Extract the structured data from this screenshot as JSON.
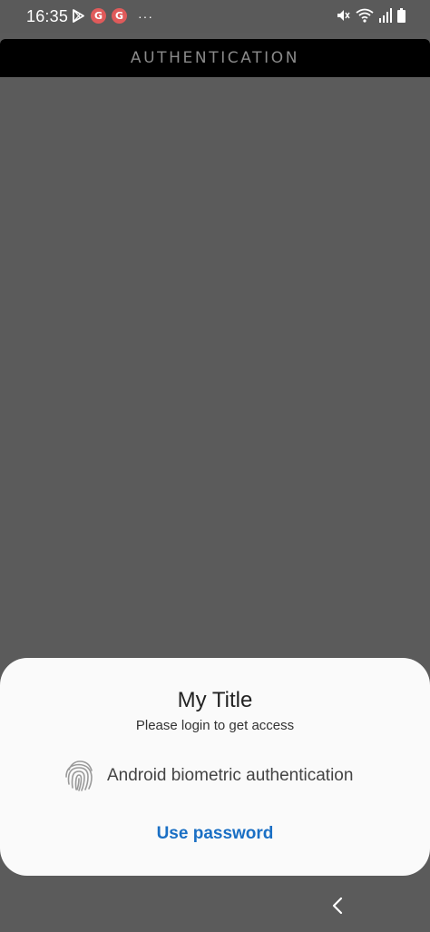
{
  "status_bar": {
    "time": "16:35",
    "left_icons": [
      "play-store-icon",
      "g-app-icon",
      "g-app-icon"
    ],
    "badge_letter": "G",
    "more": "···",
    "right_icons": [
      "vibrate-mute-icon",
      "wifi-icon",
      "signal-icon",
      "battery-icon"
    ]
  },
  "app_bar": {
    "title": "AUTHENTICATION"
  },
  "dialog": {
    "title": "My Title",
    "subtitle": "Please login to get access",
    "biometric_icon": "fingerprint-icon",
    "biometric_label": "Android biometric authentication",
    "negative_button": "Use password"
  },
  "navigation": {
    "back_icon": "chevron-left-icon"
  },
  "colors": {
    "scrim": "#5b5b5b",
    "app_bar": "#000000",
    "dialog_bg": "#fafafa",
    "accent": "#1a6fc4",
    "badge": "#e05a5a"
  }
}
